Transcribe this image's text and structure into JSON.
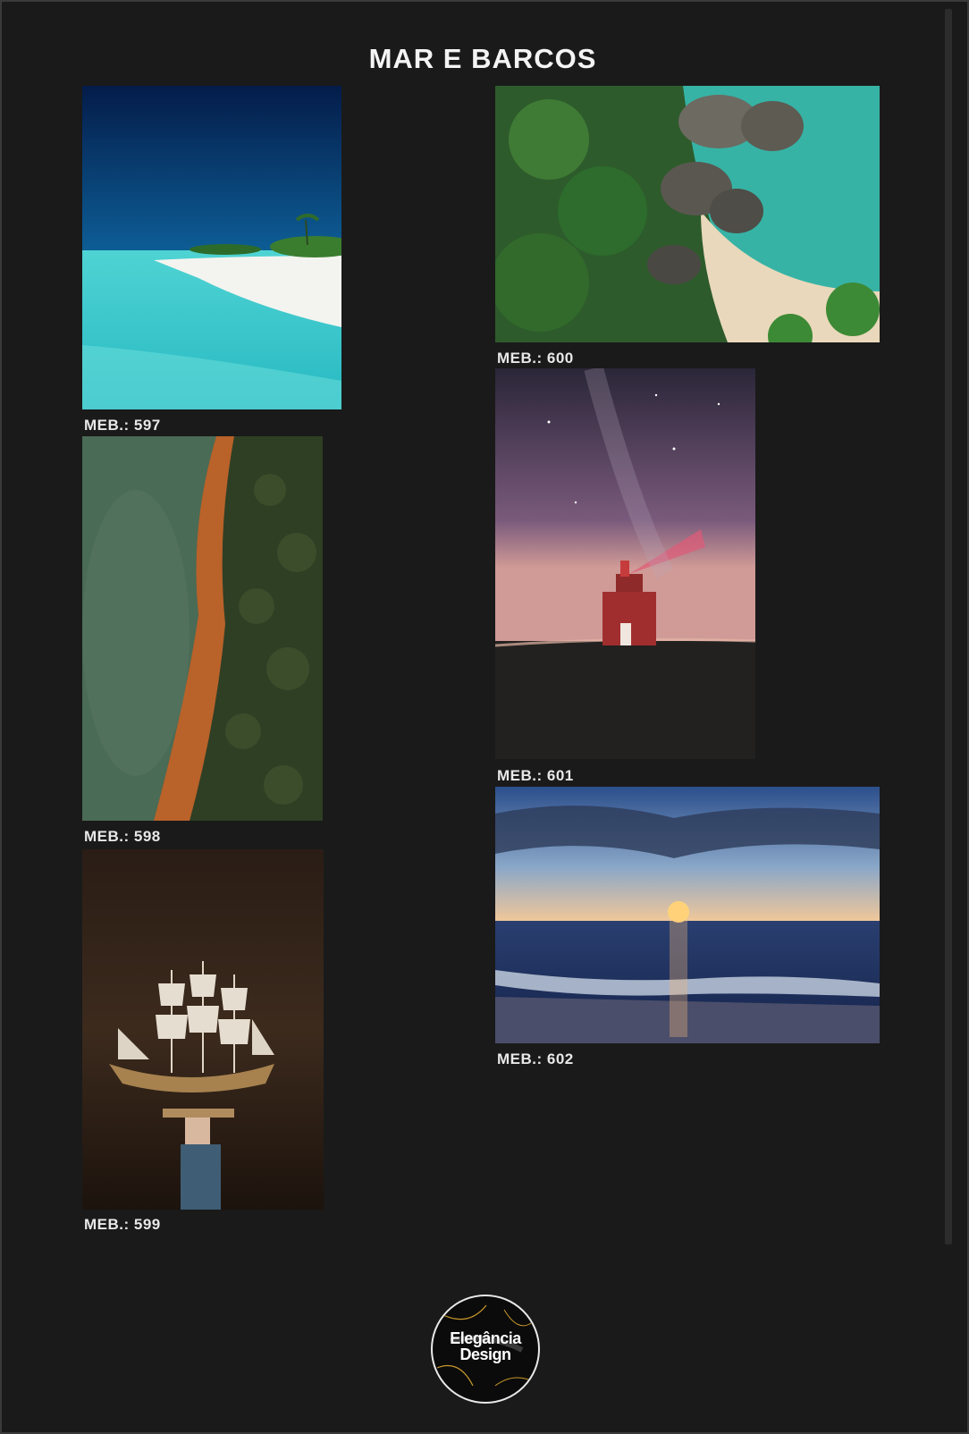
{
  "title": "MAR E BARCOS",
  "items": [
    {
      "code": "MEB.: 597"
    },
    {
      "code": "MEB.: 598"
    },
    {
      "code": "MEB.: 599"
    },
    {
      "code": "MEB.: 600"
    },
    {
      "code": "MEB.: 601"
    },
    {
      "code": "MEB.: 602"
    }
  ],
  "logo": {
    "line1": "Elegância",
    "line2": "Design"
  }
}
